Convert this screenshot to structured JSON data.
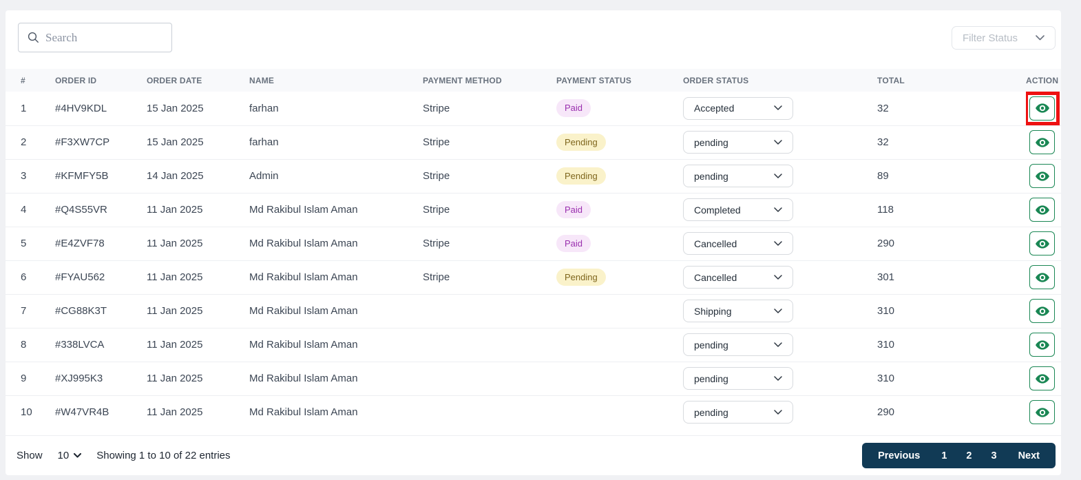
{
  "toolbar": {
    "search_placeholder": "Search",
    "filter_status_label": "Filter Status"
  },
  "table": {
    "headers": [
      "#",
      "ORDER ID",
      "ORDER DATE",
      "NAME",
      "PAYMENT METHOD",
      "PAYMENT STATUS",
      "ORDER STATUS",
      "TOTAL",
      "ACTION"
    ],
    "rows": [
      {
        "index": "1",
        "order_id": "#4HV9KDL",
        "order_date": "15 Jan 2025",
        "name": "farhan",
        "payment_method": "Stripe",
        "payment_status": "Paid",
        "order_status": "Accepted",
        "total": "32",
        "action_highlighted": true
      },
      {
        "index": "2",
        "order_id": "#F3XW7CP",
        "order_date": "15 Jan 2025",
        "name": "farhan",
        "payment_method": "Stripe",
        "payment_status": "Pending",
        "order_status": "pending",
        "total": "32",
        "action_highlighted": false
      },
      {
        "index": "3",
        "order_id": "#KFMFY5B",
        "order_date": "14 Jan 2025",
        "name": "Admin",
        "payment_method": "Stripe",
        "payment_status": "Pending",
        "order_status": "pending",
        "total": "89",
        "action_highlighted": false
      },
      {
        "index": "4",
        "order_id": "#Q4S55VR",
        "order_date": "11 Jan 2025",
        "name": "Md Rakibul Islam Aman",
        "payment_method": "Stripe",
        "payment_status": "Paid",
        "order_status": "Completed",
        "total": "118",
        "action_highlighted": false
      },
      {
        "index": "5",
        "order_id": "#E4ZVF78",
        "order_date": "11 Jan 2025",
        "name": "Md Rakibul Islam Aman",
        "payment_method": "Stripe",
        "payment_status": "Paid",
        "order_status": "Cancelled",
        "total": "290",
        "action_highlighted": false
      },
      {
        "index": "6",
        "order_id": "#FYAU562",
        "order_date": "11 Jan 2025",
        "name": "Md Rakibul Islam Aman",
        "payment_method": "Stripe",
        "payment_status": "Pending",
        "order_status": "Cancelled",
        "total": "301",
        "action_highlighted": false
      },
      {
        "index": "7",
        "order_id": "#CG88K3T",
        "order_date": "11 Jan 2025",
        "name": "Md Rakibul Islam Aman",
        "payment_method": "",
        "payment_status": "",
        "order_status": "Shipping",
        "total": "310",
        "action_highlighted": false
      },
      {
        "index": "8",
        "order_id": "#338LVCA",
        "order_date": "11 Jan 2025",
        "name": "Md Rakibul Islam Aman",
        "payment_method": "",
        "payment_status": "",
        "order_status": "pending",
        "total": "310",
        "action_highlighted": false
      },
      {
        "index": "9",
        "order_id": "#XJ995K3",
        "order_date": "11 Jan 2025",
        "name": "Md Rakibul Islam Aman",
        "payment_method": "",
        "payment_status": "",
        "order_status": "pending",
        "total": "310",
        "action_highlighted": false
      },
      {
        "index": "10",
        "order_id": "#W47VR4B",
        "order_date": "11 Jan 2025",
        "name": "Md Rakibul Islam Aman",
        "payment_method": "",
        "payment_status": "",
        "order_status": "pending",
        "total": "290",
        "action_highlighted": false
      }
    ]
  },
  "footer": {
    "show_label": "Show",
    "page_size": "10",
    "summary": "Showing 1 to 10 of 22 entries",
    "pagination": [
      "Previous",
      "1",
      "2",
      "3",
      "Next"
    ]
  },
  "icons": {
    "search": "magnifying-glass",
    "chevron": "chevron-down",
    "view": "eye"
  },
  "colors": {
    "paid_badge_bg": "#f7e7f9",
    "paid_badge_text": "#9a2fae",
    "pending_badge_bg": "#faf2ca",
    "pending_badge_text": "#7e651c",
    "action_green": "#1a8754",
    "highlight_red": "#ee1111",
    "pagination_bg": "#113a55",
    "header_row_bg": "#f8f9fb"
  }
}
